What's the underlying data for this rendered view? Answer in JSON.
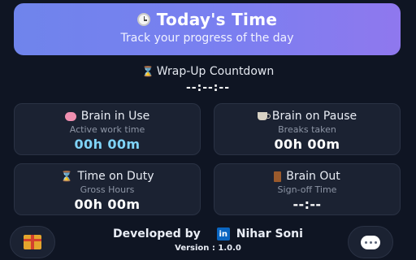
{
  "header": {
    "title": "Today's Time",
    "subtitle": "Track your progress of the day",
    "icon": "clock-icon"
  },
  "wrap_up": {
    "label": "Wrap-Up Countdown",
    "value": "--:--:--",
    "icon": "hourglass-icon"
  },
  "cards": [
    {
      "title": "Brain in Use",
      "subtitle": "Active work time",
      "value": "00h 00m",
      "icon": "brain-icon",
      "value_color": "#7fd3f7"
    },
    {
      "title": "Brain on Pause",
      "subtitle": "Breaks taken",
      "value": "00h 00m",
      "icon": "coffee-icon"
    },
    {
      "title": "Time on Duty",
      "subtitle": "Gross Hours",
      "value": "00h 00m",
      "icon": "hourglass-icon"
    },
    {
      "title": "Brain Out",
      "subtitle": "Sign-off Time",
      "value": "--:--",
      "icon": "door-icon"
    }
  ],
  "footer": {
    "developed_by": "Developed by",
    "linkedin_label": "in",
    "developer_name": "Nihar Soni",
    "version": "Version : 1.0.0"
  },
  "buttons": {
    "gift": "gift-icon",
    "chat": "chat-icon"
  },
  "colors": {
    "background": "#0f1523",
    "header_gradient_start": "#6f84ec",
    "header_gradient_end": "#8f78ee",
    "card_bg": "#1b2232",
    "accent": "#7fd3f7",
    "linkedin": "#0a66c2"
  }
}
